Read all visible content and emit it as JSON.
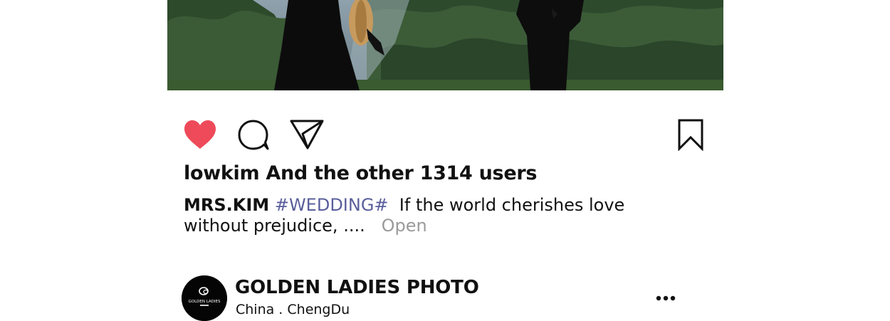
{
  "post": {
    "actions": {
      "like_icon": "heart-filled-icon",
      "comment_icon": "comment-bubble-icon",
      "share_icon": "paper-plane-icon",
      "save_icon": "bookmark-icon",
      "like_color": "#ee4a5a"
    },
    "likes_text": "lowkim And the other 1314 users",
    "caption": {
      "username": "MRS.KIM",
      "hashtag": "#WEDDING#",
      "text": "If the world cherishes love without prejudice, ....",
      "more_label": "Open"
    }
  },
  "next_post": {
    "account_name": "GOLDEN LADIES PHOTO",
    "location": "China . ChengDu",
    "avatar_text": "GOLDEN LADIES",
    "more_icon": "more-dots-icon"
  }
}
